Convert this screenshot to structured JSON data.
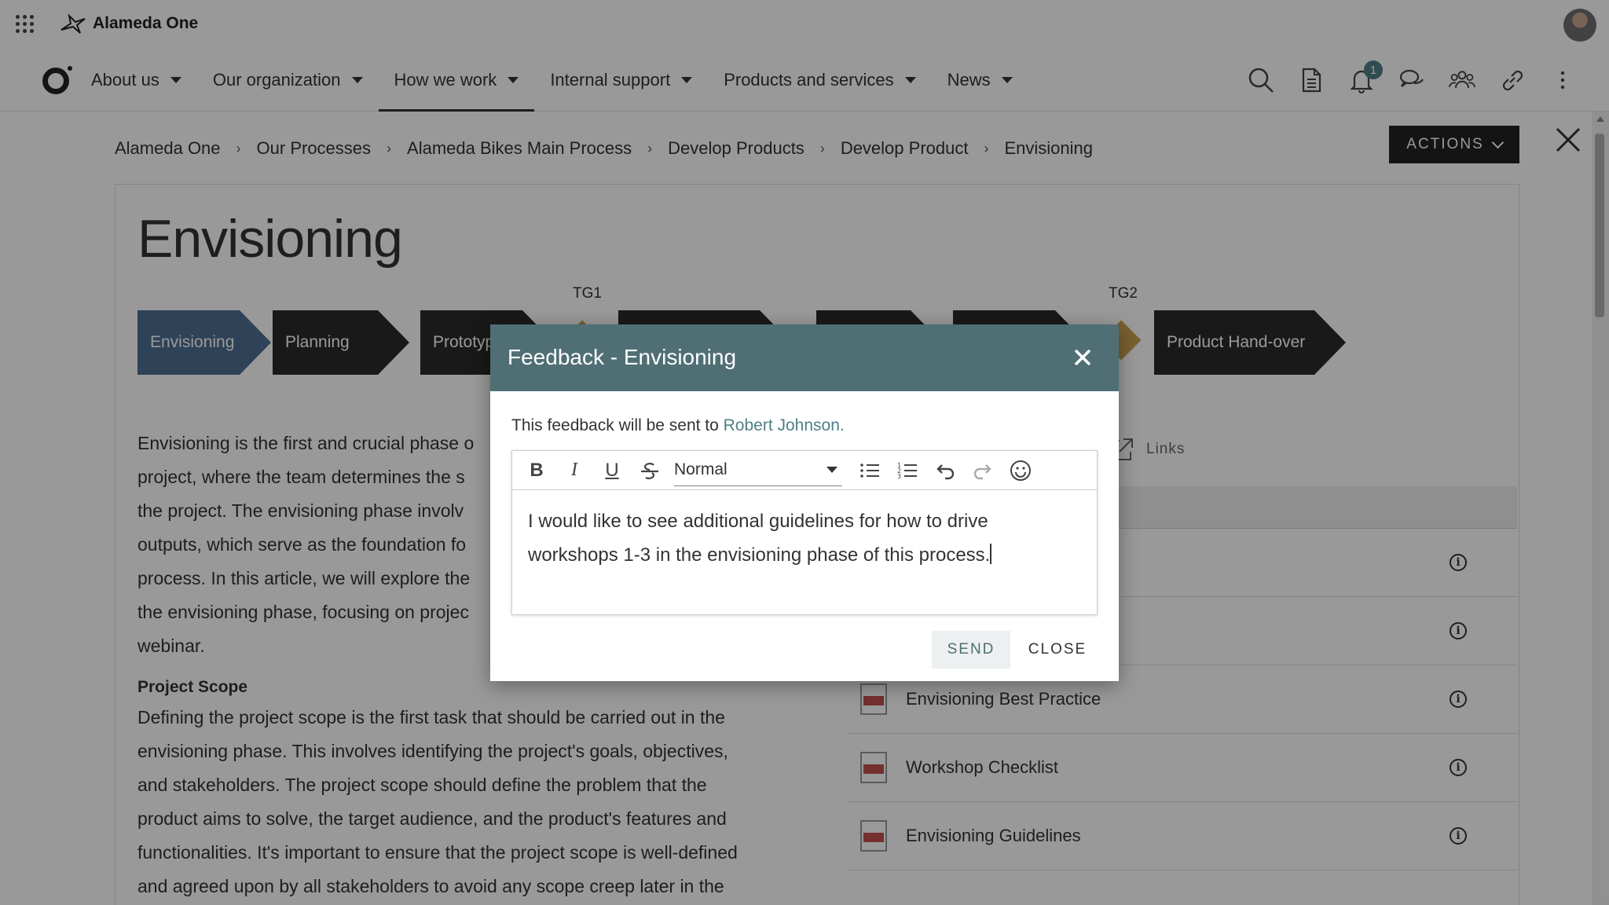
{
  "brand": {
    "name": "Alameda One"
  },
  "nav": {
    "items": [
      {
        "label": "About us",
        "active": false
      },
      {
        "label": "Our organization",
        "active": false
      },
      {
        "label": "How we work",
        "active": true
      },
      {
        "label": "Internal support",
        "active": false
      },
      {
        "label": "Products and services",
        "active": false
      },
      {
        "label": "News",
        "active": false
      }
    ],
    "notification_count": "1",
    "icons": [
      "search-icon",
      "document-icon",
      "bell-icon",
      "chat-icon",
      "people-icon",
      "link-icon",
      "more-vertical-icon"
    ]
  },
  "breadcrumb": [
    "Alameda One",
    "Our Processes",
    "Alameda Bikes Main Process",
    "Develop Products",
    "Develop Product",
    "Envisioning"
  ],
  "actions_label": "ACTIONS",
  "page": {
    "title": "Envisioning",
    "process_steps": [
      {
        "label": "Envisioning",
        "current": true
      },
      {
        "label": "Planning",
        "current": false
      },
      {
        "label": "Prototyp",
        "current": false
      },
      {
        "label": "",
        "current": false
      },
      {
        "label": "",
        "current": false
      },
      {
        "label": "",
        "current": false
      },
      {
        "label": "Product Hand-over",
        "current": false
      }
    ],
    "gates": [
      "TG1",
      "TG2"
    ],
    "intro_lines": [
      "Envisioning is the first and crucial phase o",
      "project, where the team determines the s",
      "the project. The envisioning phase involv",
      "outputs, which serve as the foundation fo",
      "process. In this article, we will explore the",
      "the envisioning phase, focusing on projec",
      "webinar."
    ],
    "section_heading": "Project Scope",
    "section_lines": [
      "Defining the project scope is the first task that should be carried out in the",
      "envisioning phase. This involves identifying the project's goals, objectives,",
      "and stakeholders. The project scope should define the problem that the",
      "product aims to solve, the target audience, and the product's features and",
      "functionalities. It's important to ensure that the project scope is well-defined",
      "and agreed upon by all stakeholders to avoid any scope creep later in the"
    ]
  },
  "sidebar": {
    "links_tab": "Links",
    "documents": [
      {
        "title": ""
      },
      {
        "title": ""
      },
      {
        "title": "Envisioning Best Practice"
      },
      {
        "title": "Workshop Checklist"
      },
      {
        "title": "Envisioning Guidelines"
      }
    ]
  },
  "dialog": {
    "title": "Feedback - Envisioning",
    "recipient_prefix": "This feedback will be sent to ",
    "recipient_name": "Robert Johnson.",
    "format_value": "Normal",
    "message_line1": "I would like to see additional guidelines for how to drive",
    "message_line2": "workshops 1-3 in the envisioning phase of this process.",
    "send_label": "SEND",
    "close_label": "CLOSE"
  },
  "colors": {
    "dialog_header": "#4f6f74",
    "current_step": "#4e6f93",
    "gate": "#c8a050",
    "recipient_link": "#4f7f86"
  }
}
